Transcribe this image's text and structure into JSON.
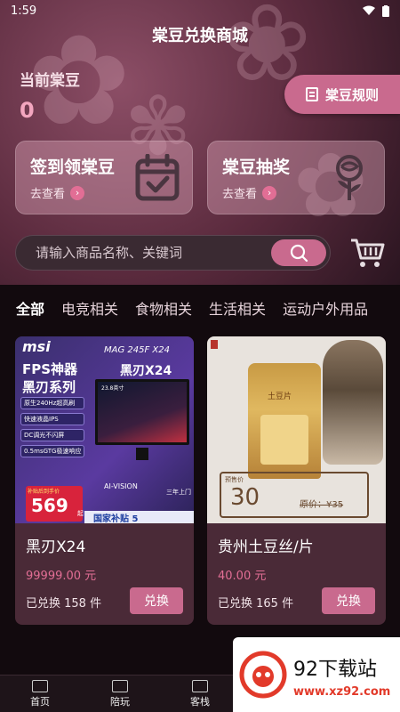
{
  "status": {
    "time": "1:59"
  },
  "title": "棠豆兑换商城",
  "balance": {
    "label": "当前棠豆",
    "value": "0"
  },
  "rules_button": "棠豆规则",
  "cards": [
    {
      "title": "签到领棠豆",
      "sub": "去查看"
    },
    {
      "title": "棠豆抽奖",
      "sub": "去查看"
    }
  ],
  "search": {
    "placeholder": "请输入商品名称、关键词"
  },
  "tabs": [
    "全部",
    "电竞相关",
    "食物相关",
    "生活相关",
    "运动户外用品"
  ],
  "products": [
    {
      "name": "黑刃X24",
      "price": "99999.00 元",
      "sold": "已兑换 158 件",
      "button": "兑换",
      "img": {
        "brand": "msi",
        "headline1": "FPS神器",
        "headline2": "黑刃系列",
        "model": "MAG 245F X24",
        "model_cn": "黑刃X24",
        "features": [
          "原生240Hz超高刷",
          "快速液晶IPS",
          "DC调光不闪屏",
          "0.5msGTG极速响应"
        ],
        "size": "23.8英寸",
        "price_tag": "补贴后到手价",
        "price_value": "569",
        "price_unit": "起",
        "partner": "AI-VISION",
        "warranty": "三年上门",
        "banner": "国家补贴 5"
      }
    },
    {
      "name": "贵州土豆丝/片",
      "price": "40.00 元",
      "sold": "已兑换 165 件",
      "button": "兑换",
      "img": {
        "bag_label": "土豆片",
        "price_label": "预售价",
        "price_value": "30",
        "original": "原价：¥35"
      }
    }
  ],
  "nav": [
    "首页",
    "陪玩",
    "客栈"
  ],
  "watermark": {
    "brand": "92下载站",
    "url": "www.xz92.com"
  },
  "colors": {
    "accent": "#c96a8e",
    "price": "#e26e95"
  }
}
